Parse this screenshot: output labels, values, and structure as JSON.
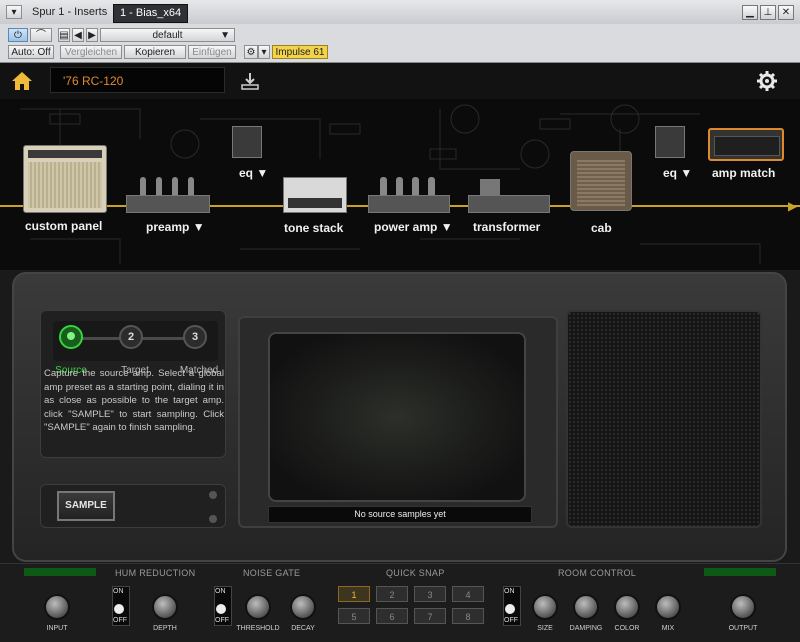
{
  "host": {
    "track_menu": "Spur 1 - Inserts",
    "plugin_tab": "1 - Bias_x64",
    "preset_name": "default",
    "auto_off": "Auto: Off",
    "compare": "Vergleichen",
    "copy": "Kopieren",
    "paste": "Einfügen",
    "impulse": "Impulse 61"
  },
  "plugin": {
    "preset_display": "'76 RC-120"
  },
  "chain": {
    "custom_panel": "custom panel",
    "preamp": "preamp",
    "eq1": "eq",
    "tone_stack": "tone stack",
    "power_amp": "power amp",
    "transformer": "transformer",
    "cab": "cab",
    "eq2": "eq",
    "amp_match": "amp match",
    "dropdown_arrow": "▼"
  },
  "amp_match": {
    "steps": [
      {
        "number": "",
        "label": "Source"
      },
      {
        "number": "2",
        "label": "Target"
      },
      {
        "number": "3",
        "label": "Matched"
      }
    ],
    "instructions": "Capture the source amp. Select a global amp preset as a starting point, dialing it in as close as possible to the target amp. click \"SAMPLE\" to start sampling. Click \"SAMPLE\" again to finish sampling.",
    "sample_button": "SAMPLE",
    "status": "No source samples yet"
  },
  "bottom": {
    "hum_reduction": "HUM REDUCTION",
    "noise_gate": "NOISE GATE",
    "quick_snap": "QUICK SNAP",
    "room_control": "ROOM CONTROL",
    "switch_on": "ON",
    "switch_off": "OFF",
    "knobs": {
      "input": "INPUT",
      "depth": "DEPTH",
      "threshold": "THRESHOLD",
      "decay": "DECAY",
      "size": "SIZE",
      "damping": "DAMPING",
      "color": "COLOR",
      "mix": "MIX",
      "output": "OUTPUT"
    },
    "snaps": [
      "1",
      "2",
      "3",
      "4",
      "5",
      "6",
      "7",
      "8"
    ]
  },
  "colors": {
    "accent_orange": "#e0892b",
    "signal_line": "#c9a227",
    "source_led": "#35d43a",
    "snap_active": "#f0b93a"
  }
}
